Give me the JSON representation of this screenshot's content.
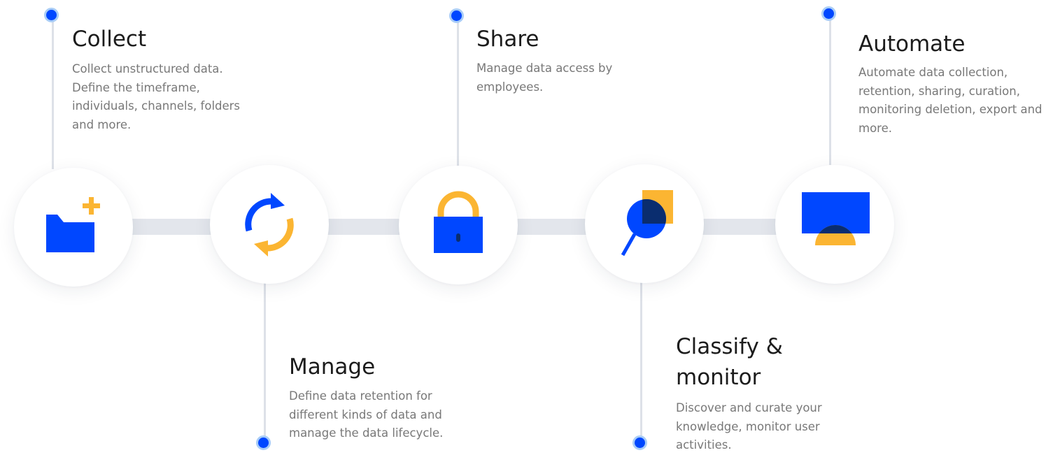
{
  "steps": [
    {
      "title": "Collect",
      "description": "Collect unstructured data. Define the timeframe, individuals, channels, folders and more.",
      "icon": "folder-plus-icon"
    },
    {
      "title": "Manage",
      "description": "Define data retention for different kinds of data and manage the data lifecycle.",
      "icon": "cycle-arrows-icon"
    },
    {
      "title": "Share",
      "description": "Manage data access by employees.",
      "icon": "padlock-icon"
    },
    {
      "title": "Classify & monitor",
      "description": "Discover and curate your knowledge, monitor user activities.",
      "icon": "magnifier-icon"
    },
    {
      "title": "Automate",
      "description": "Automate data collection, retention, sharing, curation, monitoring deletion, export and more.",
      "icon": "monitor-icon"
    }
  ],
  "colors": {
    "primary_blue": "#0047ff",
    "accent_yellow": "#fbb532",
    "dark_navy": "#0a2d6f",
    "track_gray": "#e3e6ec",
    "dot_ring": "#a9cdf7"
  }
}
